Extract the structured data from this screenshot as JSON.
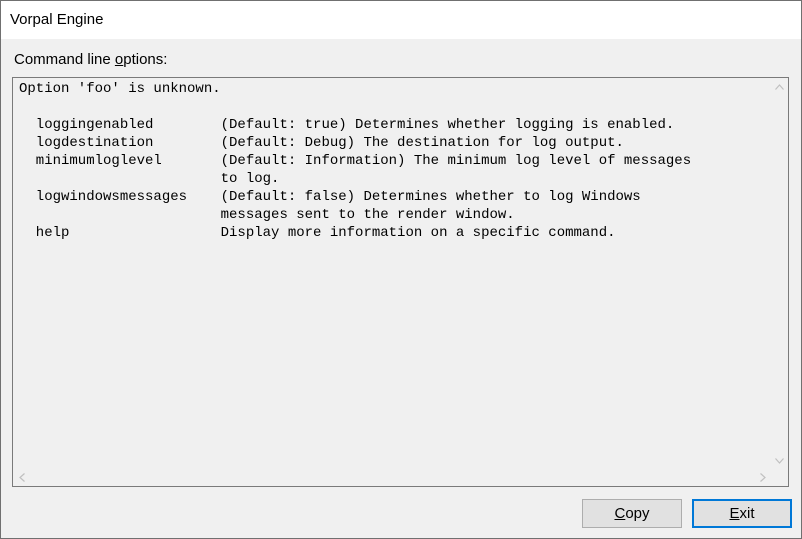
{
  "window": {
    "title": "Vorpal Engine"
  },
  "options_group": {
    "label_prefix": "Command line ",
    "label_accel": "o",
    "label_suffix": "ptions:"
  },
  "output": {
    "text": "Option 'foo' is unknown.\n\n  loggingenabled        (Default: true) Determines whether logging is enabled.\n  logdestination        (Default: Debug) The destination for log output.\n  minimumloglevel       (Default: Information) The minimum log level of messages\n                        to log.\n  logwindowsmessages    (Default: false) Determines whether to log Windows\n                        messages sent to the render window.\n  help                  Display more information on a specific command."
  },
  "buttons": {
    "copy": {
      "accel": "C",
      "rest": "opy"
    },
    "exit": {
      "accel": "E",
      "rest": "xit"
    }
  }
}
